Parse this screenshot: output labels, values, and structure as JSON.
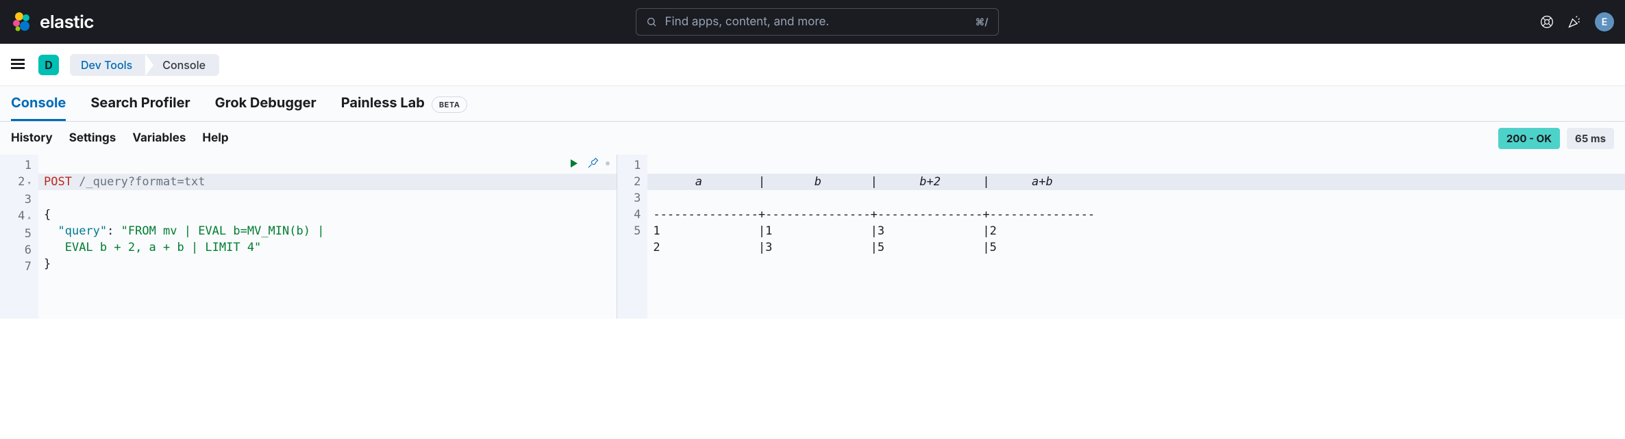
{
  "header": {
    "brand": "elastic",
    "search_placeholder": "Find apps, content, and more.",
    "search_shortcut": "⌘/",
    "avatar_initial": "E"
  },
  "breadcrumb": {
    "app_badge": "D",
    "items": [
      "Dev Tools",
      "Console"
    ]
  },
  "tabs": [
    {
      "label": "Console",
      "active": true
    },
    {
      "label": "Search Profiler",
      "active": false
    },
    {
      "label": "Grok Debugger",
      "active": false
    },
    {
      "label": "Painless Lab",
      "active": false,
      "badge": "BETA"
    }
  ],
  "toolbar": {
    "items": [
      "History",
      "Settings",
      "Variables",
      "Help"
    ],
    "status": "200 - OK",
    "time": "65 ms"
  },
  "editor": {
    "input": {
      "line_numbers": [
        "1",
        "2",
        "3",
        "4",
        "5",
        "6",
        "7"
      ],
      "method": "POST",
      "path": "/_query?format=txt",
      "body_open": "{",
      "prop": "\"query\"",
      "colon": ": ",
      "value": "\"FROM mv | EVAL b=MV_MIN(b) | EVAL b + 2, a + b | LIMIT 4\"",
      "value_part1": "\"FROM mv | EVAL b=MV_MIN(b) |",
      "value_part2": "EVAL b + 2, a + b | LIMIT 4\"",
      "body_close": "}"
    },
    "output": {
      "line_numbers": [
        "1",
        "2",
        "3",
        "4",
        "5"
      ],
      "header_row": "      a        |       b       |      b+2      |      a+b      ",
      "sep_row": "---------------+---------------+---------------+---------------",
      "rows": [
        "1              |1              |3              |2              ",
        "2              |3              |5              |5              "
      ]
    }
  }
}
